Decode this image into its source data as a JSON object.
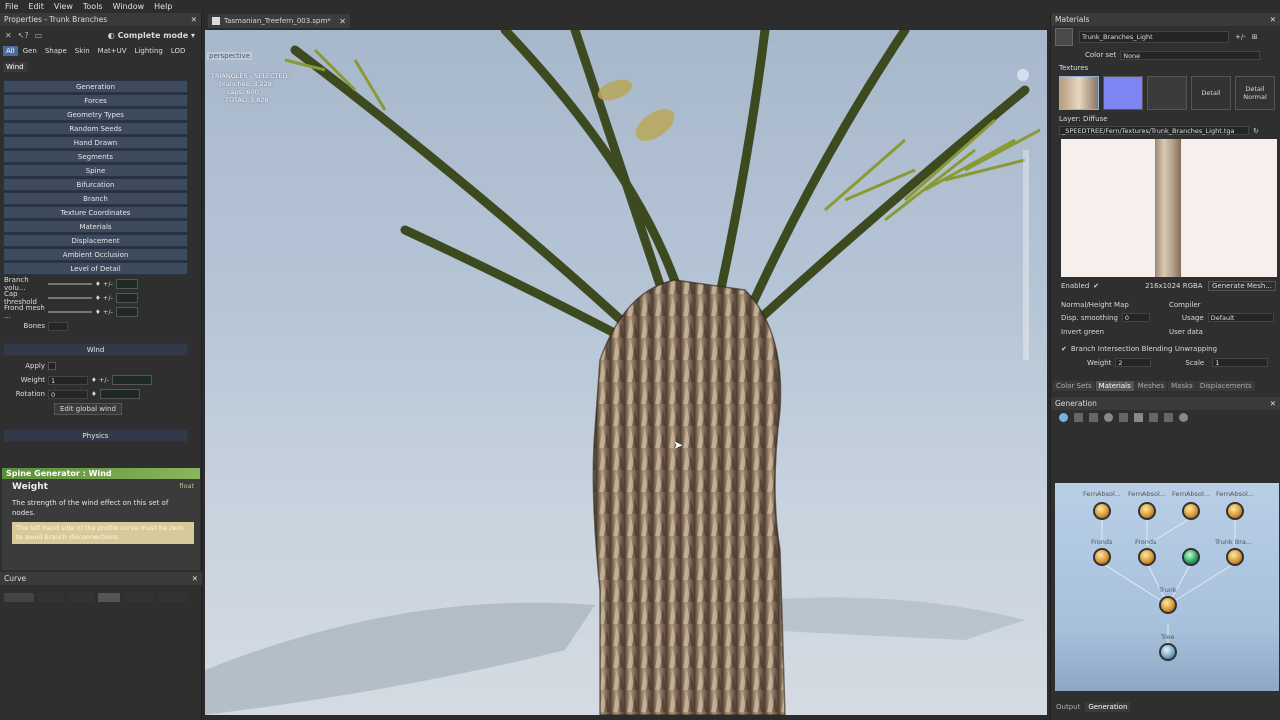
{
  "menubar": [
    "File",
    "Edit",
    "View",
    "Tools",
    "Window",
    "Help"
  ],
  "left": {
    "title": "Properties - Trunk Branches",
    "mode_label": "Complete mode",
    "tabs": [
      "All",
      "Gen",
      "Shape",
      "Skin",
      "Mat+UV",
      "Lighting",
      "LOD"
    ],
    "subtab": "Wind",
    "sections": [
      "Generation",
      "Forces",
      "Geometry Types",
      "Random Seeds",
      "Hand Drawn",
      "Segments",
      "Spine",
      "Bifurcation",
      "Branch",
      "Texture Coordinates",
      "Materials",
      "Displacement",
      "Ambient Occlusion",
      "Level of Detail"
    ],
    "lod_props": [
      {
        "label": "Branch volu..."
      },
      {
        "label": "Cap threshold"
      },
      {
        "label": "Frond mesh ..."
      }
    ],
    "bones_label": "Bones",
    "wind_header": "Wind",
    "apply_label": "Apply",
    "weight_label": "Weight",
    "weight_value": "1",
    "rotation_label": "Rotation",
    "rotation_value": "0",
    "edit_global_wind": "Edit global wind",
    "physics_header": "Physics",
    "help_title": "Spine Generator : Wind",
    "help_prop": "Weight",
    "help_type": "float",
    "help_desc": "The strength of the wind effect on this set of nodes.",
    "help_note": "The left hand side of the profile curve must be zero to avoid branch disconnections.",
    "curve_title": "Curve"
  },
  "document_tab": "Tasmanian_Treefern_003.spm*",
  "viewport": {
    "camera": "perspective",
    "stats_title": "TRIANGLES - SELECTED",
    "stats": [
      "branches: 3,228",
      "caps: 600",
      "TOTAL: 3,828"
    ]
  },
  "right": {
    "title": "Materials",
    "material_name": "Trunk_Branches_Light",
    "color_set_label": "Color set",
    "color_set_value": "None",
    "textures_label": "Textures",
    "tex_labels": [
      "Detail",
      "Detail Normal"
    ],
    "layer_label": "Layer: Diffuse",
    "texture_path": "_SPEEDTREE/Fern/Textures/Trunk_Branches_Light.tga",
    "enabled_label": "Enabled",
    "resolution": "216x1024 RGBA",
    "generate_mesh": "Generate Mesh...",
    "normal_map_label": "Normal/Height Map",
    "compiler_label": "Compiler",
    "disp_smoothing_label": "Disp. smoothing",
    "disp_smoothing_value": "0",
    "usage_label": "Usage",
    "usage_value": "Default",
    "invert_green_label": "Invert green",
    "user_data_label": "User data",
    "branch_blend_label": "Branch Intersection Blending",
    "unwrapping_label": "Unwrapping",
    "weight_label": "Weight",
    "weight_value": "2",
    "scale_label": "Scale",
    "scale_value": "1",
    "bottom_tabs": [
      "Color Sets",
      "Materials",
      "Meshes",
      "Masks",
      "Displacements"
    ],
    "generation_title": "Generation",
    "nodes_row1": [
      "FernAbsol...",
      "FernAbsol...",
      "FernAbsol...",
      "FernAbsol..."
    ],
    "nodes_row2": [
      "Fronds",
      "Fronds",
      "",
      "Trunk Bra..."
    ],
    "trunk_label": "Trunk",
    "tree_label": "Tree",
    "footer_tabs": [
      "Output",
      "Generation"
    ]
  }
}
